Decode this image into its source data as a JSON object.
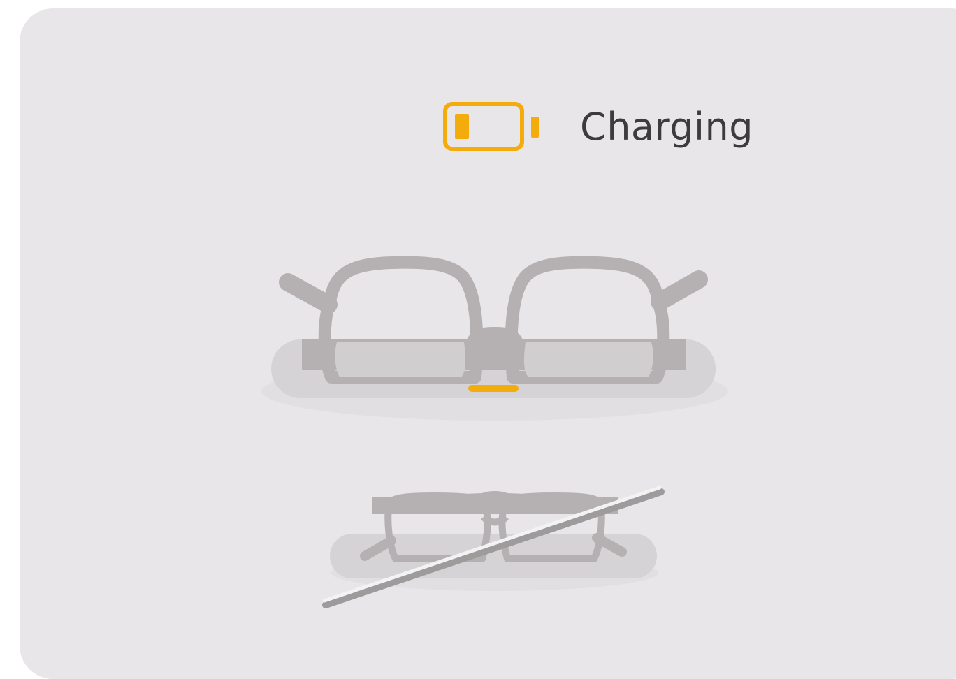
{
  "status": {
    "label": "Charging",
    "icon": "battery-low-icon",
    "accent_color": "#f4ac0c"
  },
  "illustrations": {
    "correct": "glasses-on-charger",
    "incorrect": "glasses-misplaced-crossed-out"
  }
}
